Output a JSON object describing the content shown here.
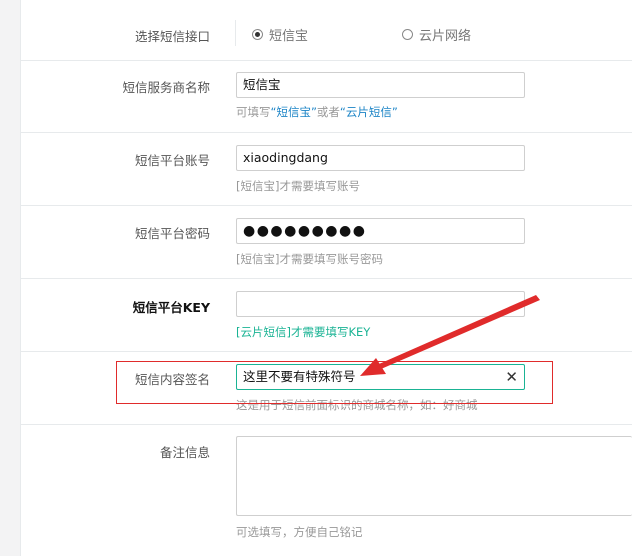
{
  "colors": {
    "accent": "#1ab394",
    "link": "#1c84c6",
    "annotation": "#e02b2b"
  },
  "form": {
    "sms_interface": {
      "label": "选择短信接口",
      "options": [
        {
          "label": "短信宝",
          "checked": true
        },
        {
          "label": "云片网络",
          "checked": false
        }
      ]
    },
    "provider_name": {
      "label": "短信服务商名称",
      "value": "短信宝",
      "help": {
        "prefix": "可填写",
        "opt1": "“短信宝”",
        "mid": "或者",
        "opt2": "“云片短信”"
      }
    },
    "account": {
      "label": "短信平台账号",
      "value": "xiaodingdang",
      "help": "[短信宝]才需要填写账号"
    },
    "password": {
      "label": "短信平台密码",
      "value": "●●●●●●●●●",
      "help": "[短信宝]才需要填写账号密码"
    },
    "api_key": {
      "label": "短信平台KEY",
      "value": "",
      "help": "[云片短信]才需要填写KEY"
    },
    "signature": {
      "label": "短信内容签名",
      "value": "这里不要有特殊符号",
      "clear_icon": "close-icon",
      "help": "这是用于短信前面标识的商城名称，如：好商城"
    },
    "remark": {
      "label": "备注信息",
      "value": "",
      "help": "可选填写，方便自己铭记"
    }
  }
}
